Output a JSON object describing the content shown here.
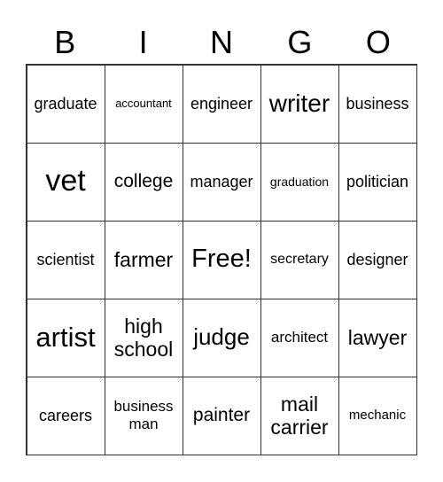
{
  "header": [
    "B",
    "I",
    "N",
    "G",
    "O"
  ],
  "cells": [
    [
      "graduate",
      "accountant",
      "engineer",
      "writer",
      "business"
    ],
    [
      "vet",
      "college",
      "manager",
      "graduation",
      "politician"
    ],
    [
      "scientist",
      "farmer",
      "Free!",
      "secretary",
      "designer"
    ],
    [
      "artist",
      "high school",
      "judge",
      "architect",
      "lawyer"
    ],
    [
      "careers",
      "business man",
      "painter",
      "mail carrier",
      "mechanic"
    ]
  ]
}
